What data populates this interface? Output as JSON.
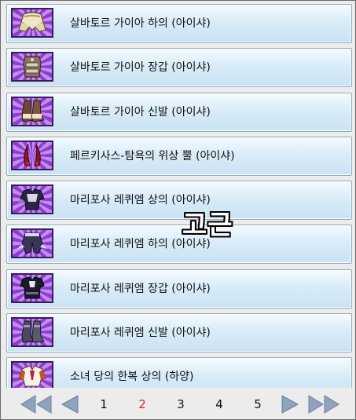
{
  "items": [
    {
      "label": "살바토르 가이아 하의 (아이샤)",
      "icon": "gaia-pants-icon"
    },
    {
      "label": "살바토르 가이아 장갑 (아이샤)",
      "icon": "gaia-gloves-icon"
    },
    {
      "label": "살바토르 가이아 신발 (아이샤)",
      "icon": "gaia-shoes-icon"
    },
    {
      "label": "페르키사스-탐욕의 위상 뿔 (아이샤)",
      "icon": "horn-icon"
    },
    {
      "label": "마리포사 레퀴엠 상의 (아이샤)",
      "icon": "requiem-top-icon"
    },
    {
      "label": "마리포사 레퀴엠 하의 (아이샤)",
      "icon": "requiem-pants-icon"
    },
    {
      "label": "마리포사 레퀴엠 장갑 (아이샤)",
      "icon": "requiem-gloves-icon"
    },
    {
      "label": "마리포사 레퀴엠 신발 (아이샤)",
      "icon": "requiem-shoes-icon"
    },
    {
      "label": "소녀 당의 한복 상의 (하양)",
      "icon": "hanbok-top-icon"
    }
  ],
  "watermark": "고근",
  "pagination": {
    "pages": [
      "1",
      "2",
      "3",
      "4",
      "5"
    ],
    "current": "2"
  },
  "colors": {
    "row_top": "#f4fbff",
    "row_bottom": "#c9e2f3",
    "row_border": "#8ea9bd",
    "thumb_bg": "#8a3fd0",
    "current_page": "#e0241f",
    "arrow": "#8fa3bf"
  }
}
